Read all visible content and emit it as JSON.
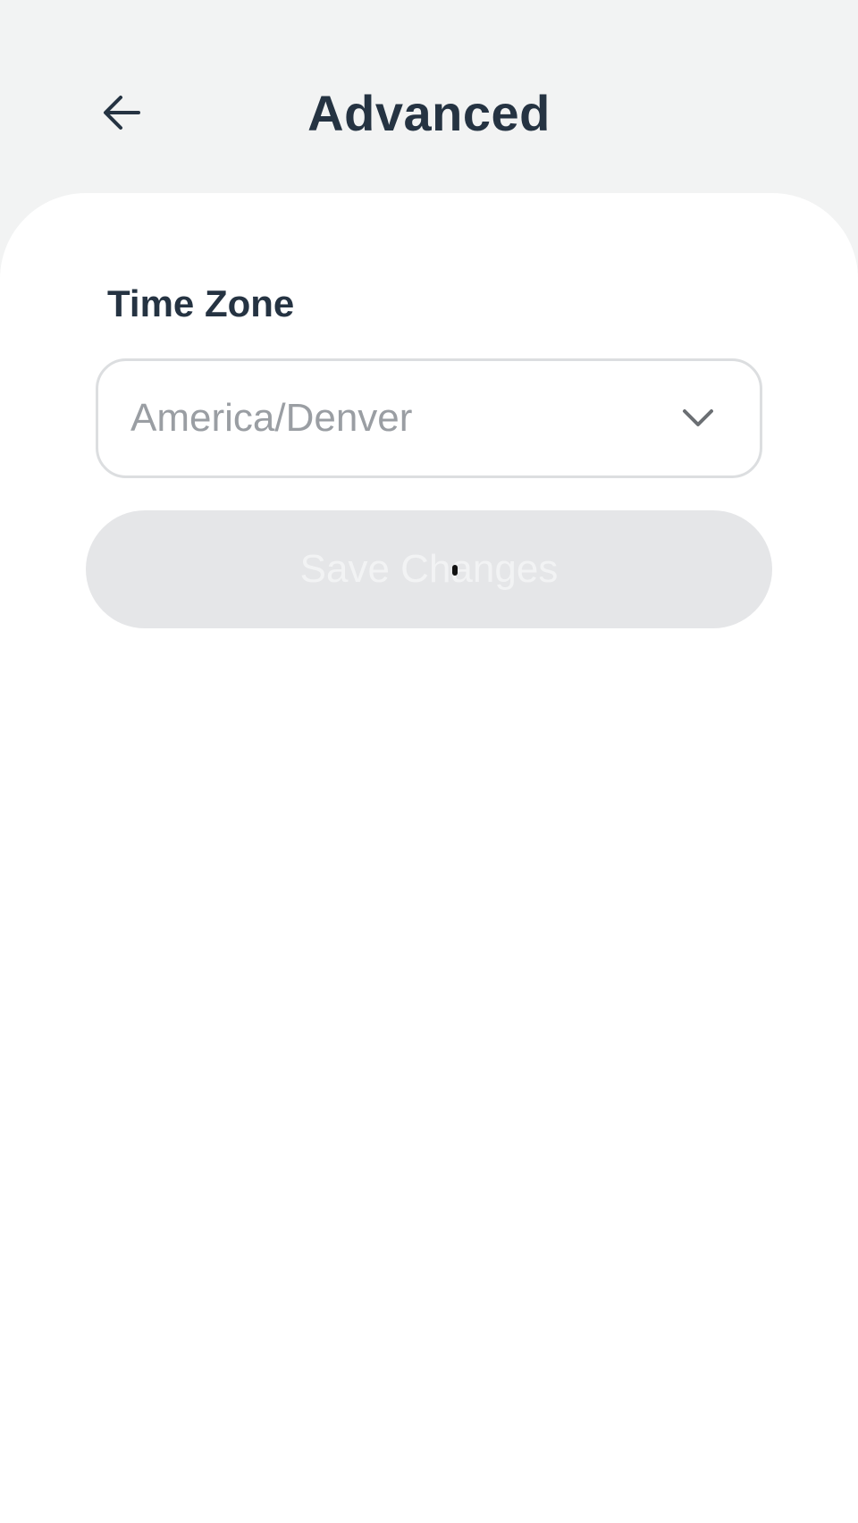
{
  "header": {
    "title": "Advanced",
    "back_icon": "arrow-left-icon"
  },
  "time_zone": {
    "label": "Time Zone",
    "selected_value": "America/Denver",
    "dropdown_icon": "chevron-down-icon"
  },
  "actions": {
    "save_label": "Save Changes",
    "save_disabled": true
  },
  "colors": {
    "background": "#f2f3f3",
    "text_primary": "#253342",
    "text_muted": "#9a9ea3",
    "button_disabled_bg": "#e5e6e8"
  }
}
